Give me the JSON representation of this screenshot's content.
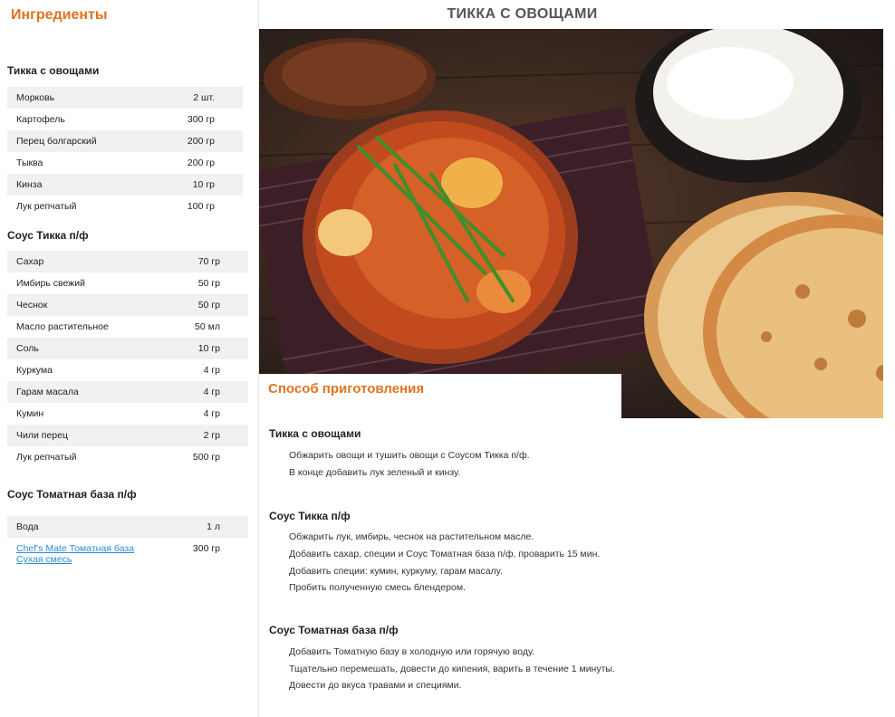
{
  "ingredients": {
    "heading": "Ингредиенты",
    "sections": [
      {
        "title": "Тикка с овощами",
        "items": [
          {
            "name": "Морковь",
            "qty": "2 шт."
          },
          {
            "name": "Картофель",
            "qty": "300 гр"
          },
          {
            "name": "Перец болгарский",
            "qty": "200 гр"
          },
          {
            "name": "Тыква",
            "qty": "200 гр"
          },
          {
            "name": "Кинза",
            "qty": "10 гр"
          },
          {
            "name": "Лук репчатый",
            "qty": "100 гр"
          }
        ]
      },
      {
        "title": "Соус Тикка п/ф",
        "items": [
          {
            "name": "Сахар",
            "qty": "70 гр"
          },
          {
            "name": "Имбирь свежий",
            "qty": "50 гр"
          },
          {
            "name": "Чеснок",
            "qty": "50 гр"
          },
          {
            "name": "Масло растительное",
            "qty": "50 мл"
          },
          {
            "name": "Соль",
            "qty": "10 гр"
          },
          {
            "name": "Куркума",
            "qty": "4 гр"
          },
          {
            "name": "Гарам масала",
            "qty": "4 гр"
          },
          {
            "name": "Кумин",
            "qty": "4 гр"
          },
          {
            "name": "Чили перец",
            "qty": "2 гр"
          },
          {
            "name": "Лук репчатый",
            "qty": "500 гр"
          }
        ]
      },
      {
        "title": "Соус Томатная база п/ф",
        "items": [
          {
            "name": "Вода",
            "qty": "1 л"
          },
          {
            "name": "Chef's Mate Томатная база",
            "name2": "Сухая смесь",
            "qty": "300 гр"
          }
        ]
      }
    ]
  },
  "recipe": {
    "title": "ТИККА С ОВОЩАМИ",
    "method_heading": "Способ приготовления",
    "steps": [
      {
        "title": "Тикка с овощами",
        "lines": [
          "Обжарить овощи и тушить овощи с Соусом Тикка п/ф.",
          "В конце добавить лук зеленый и кинзу."
        ]
      },
      {
        "title": "Соус Тикка п/ф",
        "lines": [
          "Обжарить лук, имбирь, чеснок на растительном масле.",
          "Добавить сахар, специи и Соус Томатная база п/ф, проварить 15 мин.",
          "Добавить специи: кумин, куркуму, гарам масалу.",
          "Пробить полученную смесь блендером."
        ]
      },
      {
        "title": "Соус Томатная база п/ф",
        "lines": [
          "Добавить Томатную базу в холодную или горячую воду.",
          "Тщательно перемешать, довести до кипения, варить в течение 1 минуты.",
          "Довести до вкуса травами и специями."
        ]
      }
    ]
  }
}
